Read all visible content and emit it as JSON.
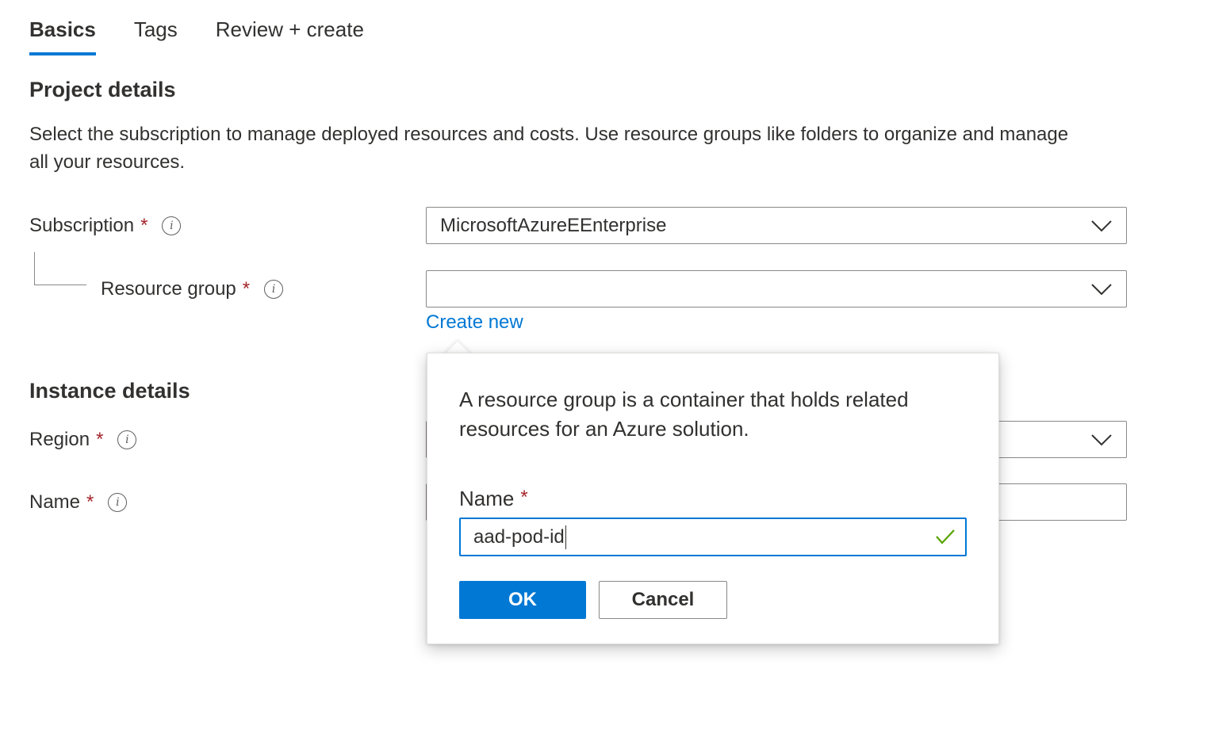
{
  "tabs": [
    {
      "label": "Basics",
      "active": true
    },
    {
      "label": "Tags",
      "active": false
    },
    {
      "label": "Review + create",
      "active": false
    }
  ],
  "project_details": {
    "title": "Project details",
    "description": "Select the subscription to manage deployed resources and costs. Use resource groups like folders to organize and manage all your resources."
  },
  "fields": {
    "subscription": {
      "label": "Subscription",
      "required_mark": "*",
      "value": "MicrosoftAzureEEnterprise"
    },
    "resource_group": {
      "label": "Resource group",
      "required_mark": "*",
      "value": "",
      "create_new_link": "Create new"
    },
    "region": {
      "label": "Region",
      "required_mark": "*"
    },
    "name": {
      "label": "Name",
      "required_mark": "*"
    }
  },
  "instance_details": {
    "title": "Instance details"
  },
  "callout": {
    "text": "A resource group is a container that holds related resources for an Azure solution.",
    "name_label": "Name",
    "required_mark": "*",
    "name_value": "aad-pod-id",
    "ok_label": "OK",
    "cancel_label": "Cancel"
  },
  "icons": {
    "info": "info-icon",
    "chevron": "chevron-down-icon",
    "check": "checkmark-icon"
  },
  "colors": {
    "accent": "#0078d4",
    "required": "#a4262c",
    "valid": "#57a300"
  }
}
